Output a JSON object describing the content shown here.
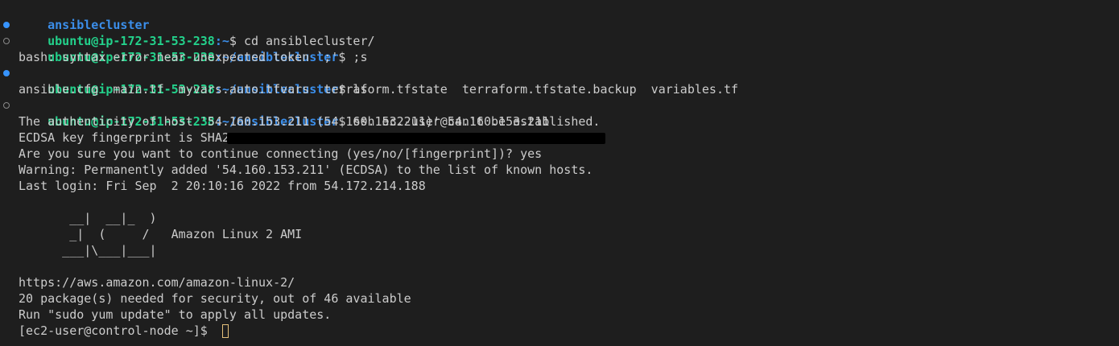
{
  "lines": {
    "l0": "ansiblecluster",
    "l1": {
      "user": "ubuntu@ip-172-31-53-238",
      "path": ":~",
      "cmd": "$ cd ansiblecluster/"
    },
    "l2": {
      "user": "ubuntu@ip-172-31-53-238",
      "path": ":~/ansiblecluster",
      "cmd": "$ ;s"
    },
    "l3": "bash: syntax error near unexpected token `;'",
    "l4": {
      "user": "ubuntu@ip-172-31-53-238",
      "path": ":~/ansiblecluster",
      "cmd": "$ ls"
    },
    "l5": "ansible.cfg  main.tf  myvars.auto.tfvars  terraform.tfstate  terraform.tfstate.backup  variables.tf",
    "l6": {
      "user": "ubuntu@ip-172-31-53-238",
      "path": ":~/ansiblecluster",
      "cmd": "$ ssh ec2-user@54.160.153.211"
    },
    "l7": "The authenticity of host '54.160.153.211 (54.160.153.211)' can't be established.",
    "l8": "ECDSA key fingerprint is SHA2",
    "l9": "Are you sure you want to continue connecting (yes/no/[fingerprint])? yes",
    "l10": "Warning: Permanently added '54.160.153.211' (ECDSA) to the list of known hosts.",
    "l11": "Last login: Fri Sep  2 20:10:16 2022 from 54.172.214.188",
    "banner1": "       __|  __|_  )",
    "banner2": "       _|  (     /   Amazon Linux 2 AMI",
    "banner3": "      ___|\\___|___|",
    "l15": "https://aws.amazon.com/amazon-linux-2/",
    "l16": "20 package(s) needed for security, out of 46 available",
    "l17": "Run \"sudo yum update\" to apply all updates.",
    "l18": "[ec2-user@control-node ~]$ "
  },
  "colors": {
    "background": "#1e1e1e",
    "prompt_user": "#23d18b",
    "prompt_path": "#3b8eea",
    "text": "#cccccc",
    "dot_success": "#3794ff",
    "cursor": "#e5c07b"
  }
}
